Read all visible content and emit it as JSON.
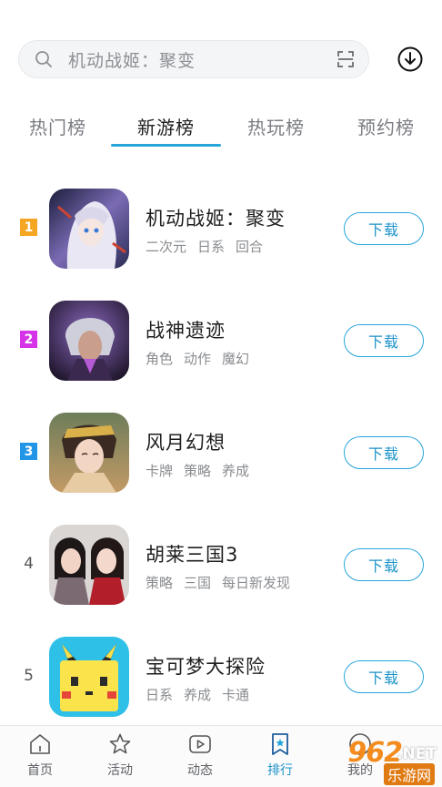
{
  "search": {
    "placeholder": "机动战姬：聚变"
  },
  "tabs": [
    {
      "label": "热门榜",
      "active": false
    },
    {
      "label": "新游榜",
      "active": true
    },
    {
      "label": "热玩榜",
      "active": false
    },
    {
      "label": "预约榜",
      "active": false
    }
  ],
  "games": [
    {
      "rank": "1",
      "name": "机动战姬：聚变",
      "tags": [
        "二次元",
        "日系",
        "回合"
      ],
      "button": "下载",
      "badge_color": "#f5a623"
    },
    {
      "rank": "2",
      "name": "战神遗迹",
      "tags": [
        "角色",
        "动作",
        "魔幻"
      ],
      "button": "下载",
      "badge_color": "#d633e8"
    },
    {
      "rank": "3",
      "name": "风月幻想",
      "tags": [
        "卡牌",
        "策略",
        "养成"
      ],
      "button": "下载",
      "badge_color": "#2196e6"
    },
    {
      "rank": "4",
      "name": "胡莱三国3",
      "tags": [
        "策略",
        "三国",
        "每日新发现"
      ],
      "button": "下载",
      "badge_color": ""
    },
    {
      "rank": "5",
      "name": "宝可梦大探险",
      "tags": [
        "日系",
        "养成",
        "卡通"
      ],
      "button": "下载",
      "badge_color": ""
    }
  ],
  "nav": [
    {
      "label": "首页",
      "icon": "home-icon"
    },
    {
      "label": "活动",
      "icon": "star-icon"
    },
    {
      "label": "动态",
      "icon": "video-icon"
    },
    {
      "label": "排行",
      "icon": "ranking-icon"
    },
    {
      "label": "我的",
      "icon": "user-icon"
    }
  ],
  "watermark": {
    "num": "962",
    "net": ".NET",
    "sub": "乐游网"
  },
  "colors": {
    "accent": "#27a6dc",
    "rank1": "#f5a623",
    "rank2": "#d633e8",
    "rank3": "#2196e6"
  }
}
